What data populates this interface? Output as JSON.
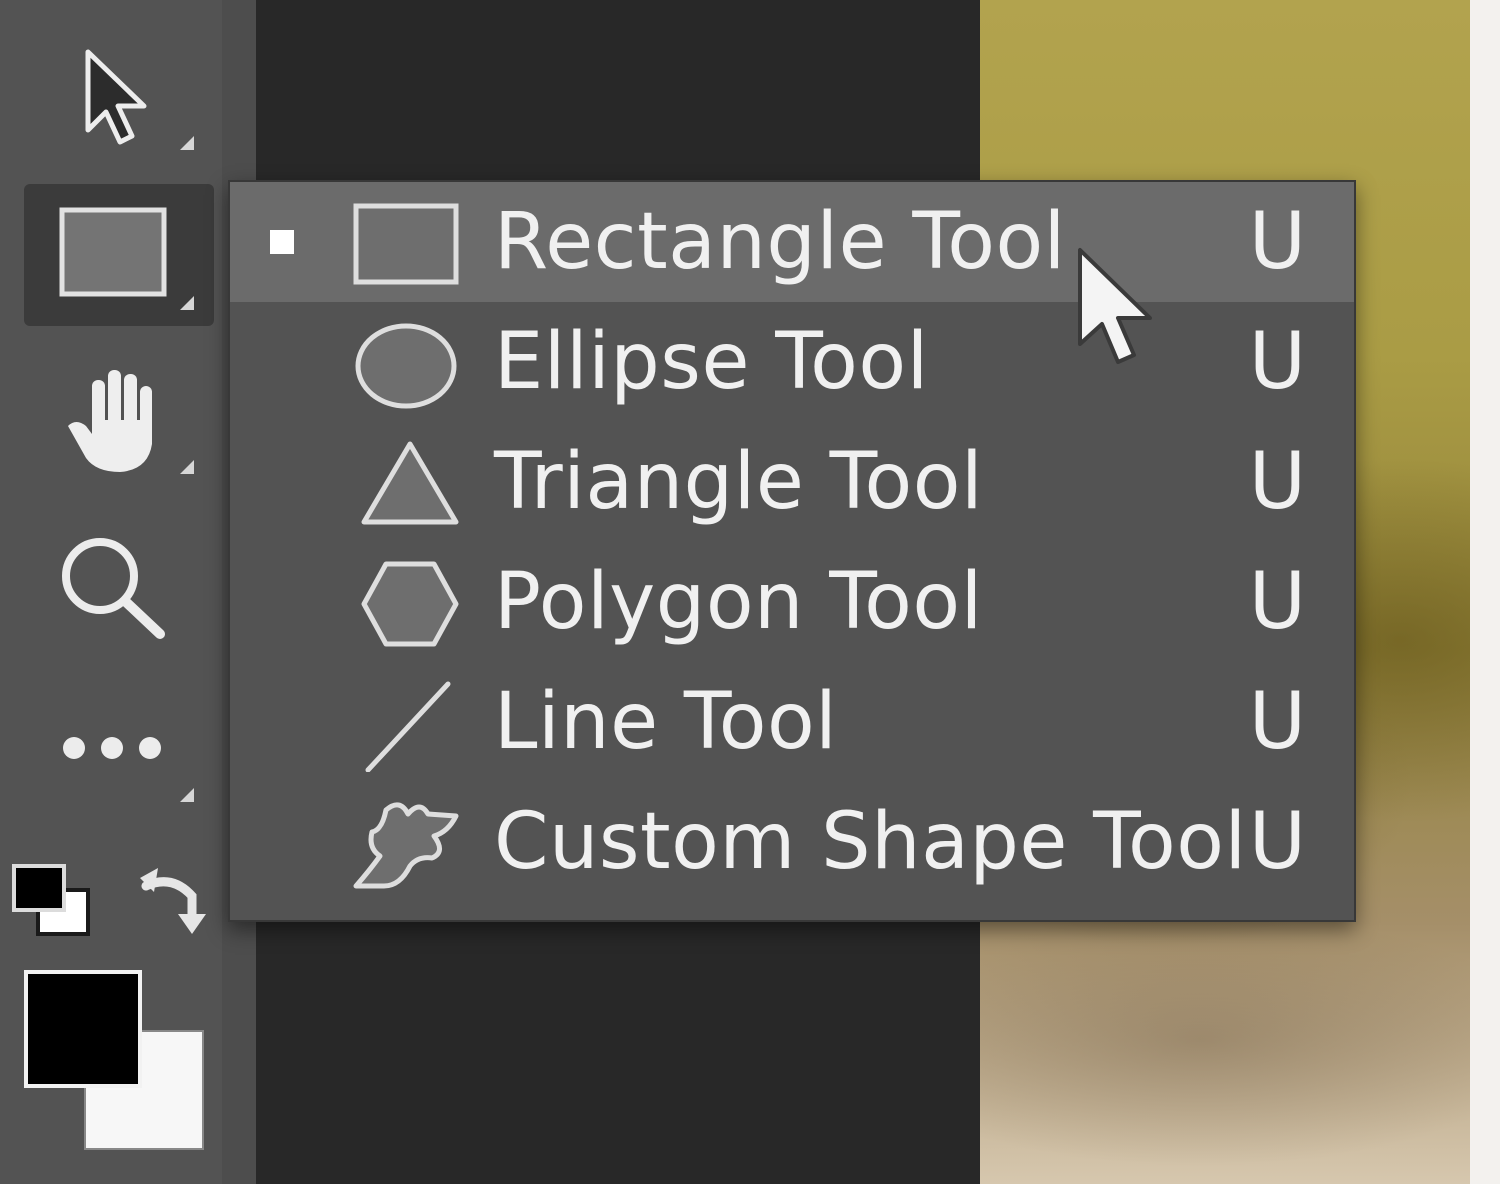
{
  "toolbar": {
    "tools": [
      {
        "name": "move-tool",
        "icon": "arrow-pointer-icon"
      },
      {
        "name": "rectangle-tool",
        "icon": "rectangle-icon",
        "selected": true
      },
      {
        "name": "hand-tool",
        "icon": "hand-icon"
      },
      {
        "name": "zoom-tool",
        "icon": "magnifier-icon"
      },
      {
        "name": "edit-toolbar",
        "icon": "more-dots-icon"
      }
    ],
    "foreground_color": "#000000",
    "background_color": "#ffffff"
  },
  "menu": {
    "items": [
      {
        "label": "Rectangle Tool",
        "shortcut": "U",
        "icon": "rectangle-icon",
        "active": true
      },
      {
        "label": "Ellipse Tool",
        "shortcut": "U",
        "icon": "ellipse-icon"
      },
      {
        "label": "Triangle Tool",
        "shortcut": "U",
        "icon": "triangle-icon"
      },
      {
        "label": "Polygon Tool",
        "shortcut": "U",
        "icon": "polygon-icon"
      },
      {
        "label": "Line Tool",
        "shortcut": "U",
        "icon": "line-icon"
      },
      {
        "label": "Custom Shape Tool",
        "shortcut": "U",
        "icon": "custom-shape-icon"
      }
    ]
  },
  "colors": {
    "panel": "#535353",
    "menu_highlight": "#6b6b6b",
    "workspace": "#282828",
    "text": "#f0f0f0"
  }
}
